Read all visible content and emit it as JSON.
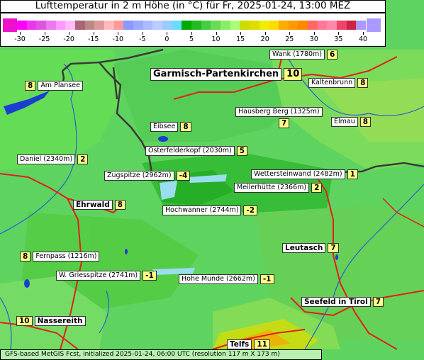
{
  "title": "Lufttemperatur in 2 m Höhe (in °C) für Fr, 2025-01-24, 13:00 MEZ",
  "footer": "GFS-based MetGIS Fcst, initialized 2025-01-24, 06:00 UTC  (resolution 117 m X 173 m)",
  "legend": {
    "ticks": [
      "-30",
      "-25",
      "-20",
      "-15",
      "-10",
      "-5",
      "0",
      "5",
      "10",
      "15",
      "20",
      "25",
      "30",
      "35",
      "40"
    ],
    "colors": [
      "#ff00ff",
      "#ee33ee",
      "#dd55dd",
      "#ee77ee",
      "#ff99ff",
      "#ffbbff",
      "#aa6677",
      "#bb8888",
      "#dd9999",
      "#ffbbbb",
      "#ff9999",
      "#8899ff",
      "#99aaff",
      "#aabbff",
      "#bbccff",
      "#99ccff",
      "#66ddff",
      "#00aa00",
      "#22bb22",
      "#44cc44",
      "#66dd55",
      "#88ee66",
      "#aaff77",
      "#ccdd00",
      "#dddd00",
      "#eeee00",
      "#ffdd00",
      "#ffaa00",
      "#ff9900",
      "#ff8800",
      "#ff6666",
      "#ff7799",
      "#ff88aa",
      "#ee4466",
      "#cc2244",
      "#aa99ff"
    ],
    "low_end_color": "#ee11cc",
    "high_end_color": "#aa99ff"
  },
  "stations": [
    {
      "name": "Wank (1780m)",
      "value": "6"
    },
    {
      "name": "Garmisch-Partenkirchen",
      "value": "10"
    },
    {
      "name": "Am Plansee",
      "value": "8"
    },
    {
      "name": "Kaltenbrunn",
      "value": "8"
    },
    {
      "name": "Hausberg Berg (1325m)",
      "value": "7"
    },
    {
      "name": "Elmau",
      "value": "8"
    },
    {
      "name": "Eibsee",
      "value": "8"
    },
    {
      "name": "Osterfelderkopf (2030m)",
      "value": "5"
    },
    {
      "name": "Daniel (2340m)",
      "value": "2"
    },
    {
      "name": "Zugspitze (2962m)",
      "value": "-4"
    },
    {
      "name": "Wettersteinwand (2482m)",
      "value": "1"
    },
    {
      "name": "Meilerhütte (2366m)",
      "value": "2"
    },
    {
      "name": "Ehrwald",
      "value": "8"
    },
    {
      "name": "Hochwanner (2744m)",
      "value": "-2"
    },
    {
      "name": "Fernpass (1216m)",
      "value": "8"
    },
    {
      "name": "Leutasch",
      "value": "7"
    },
    {
      "name": "W. Griesspitze (2741m)",
      "value": "-1"
    },
    {
      "name": "Hohe Munde (2662m)",
      "value": "-1"
    },
    {
      "name": "Seefeld in Tirol",
      "value": "7"
    },
    {
      "name": "Nassereith",
      "value": "10"
    },
    {
      "name": "Telfs",
      "value": "11"
    }
  ],
  "colors": {
    "map_base": "#5fd35f",
    "border_line": "#3a3a3a",
    "roads": "#e0201a",
    "rivers": "#2a5fd0",
    "lakes": "#1a3fd0",
    "snow": "#99ddee"
  }
}
